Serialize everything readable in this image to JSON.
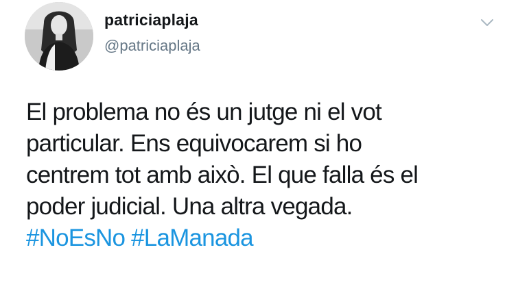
{
  "tweet": {
    "display_name": "patriciaplaja",
    "handle": "@patriciaplaja",
    "text_lines": [
      "El problema no és un jutge ni el vot",
      "particular. Ens equivocarem si ho",
      "centrem tot amb això. El que falla és el",
      "poder judicial. Una altra vegada."
    ],
    "hashtags": [
      "#NoEsNo",
      "#LaManada"
    ]
  },
  "icons": {
    "avatar": "profile-photo",
    "menu": "chevron-down-icon"
  },
  "colors": {
    "text": "#14171a",
    "secondary": "#657786",
    "link": "#1b95e0",
    "chevron": "#aab8c2"
  }
}
